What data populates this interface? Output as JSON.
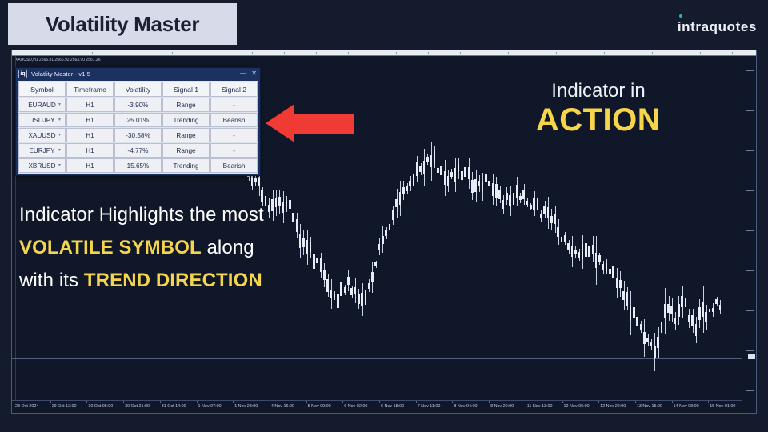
{
  "header": {
    "title": "Volatility Master",
    "brand": "intraquotes",
    "brand_accent": "#1fb8a6"
  },
  "chart": {
    "status_line": "XAUUSD,H1  2566.81 2566.92 2563.90 2567.26",
    "symbol": "XAUUSD",
    "timeframe": "H1",
    "ohlc": [
      "2566.81",
      "2566.92",
      "2563.90",
      "2567.26"
    ],
    "background": "#101728",
    "candle_color": "#e7ecf6",
    "time_labels": [
      "28 Oct 2024",
      "29 Oct 12:00",
      "30 Oct 05:00",
      "30 Oct 21:00",
      "31 Oct 14:00",
      "1 Nov 07:00",
      "1 Nov 23:00",
      "4 Nov 16:00",
      "5 Nov 09:00",
      "6 Nov 02:00",
      "6 Nov 18:00",
      "7 Nov 11:00",
      "8 Nov 04:00",
      "8 Nov 20:00",
      "11 Nov 13:00",
      "12 Nov 06:00",
      "12 Nov 22:00",
      "13 Nov 15:00",
      "14 Nov 08:00",
      "15 Nov 01:00"
    ]
  },
  "panel": {
    "title": "Volatlity Master - v1.5",
    "logo": "iq",
    "minimize": "—",
    "close": "✕",
    "columns": [
      "Symbol",
      "Timeframe",
      "Volatility",
      "Signal 1",
      "Signal 2"
    ],
    "rows": [
      {
        "symbol": "EURAUD",
        "timeframe": "H1",
        "volatility": "-3.90%",
        "signal1": "Range",
        "signal2": "-",
        "emphasis": "dim"
      },
      {
        "symbol": "USDJPY",
        "timeframe": "H1",
        "volatility": "25.01%",
        "signal1": "Trending",
        "signal2": "Bearish",
        "emphasis": "strong"
      },
      {
        "symbol": "XAUUSD",
        "timeframe": "H1",
        "volatility": "-30.58%",
        "signal1": "Range",
        "signal2": "-",
        "emphasis": "dim"
      },
      {
        "symbol": "EURJPY",
        "timeframe": "H1",
        "volatility": "-4.77%",
        "signal1": "Range",
        "signal2": "-",
        "emphasis": "dim"
      },
      {
        "symbol": "XBRUSD",
        "timeframe": "H1",
        "volatility": "15.65%",
        "signal1": "Trending",
        "signal2": "Bearish",
        "emphasis": "normal"
      }
    ]
  },
  "annotations": {
    "arrow_color": "#ef3b33",
    "action_line1": "Indicator in",
    "action_line2": "ACTION",
    "copy_line1": "Indicator Highlights the most",
    "copy_line2_a": "VOLATILE SYMBOL",
    "copy_line2_b": " along",
    "copy_line3_a": "with its ",
    "copy_line3_b": "TREND DIRECTION",
    "highlight_color": "#f5d54e"
  }
}
